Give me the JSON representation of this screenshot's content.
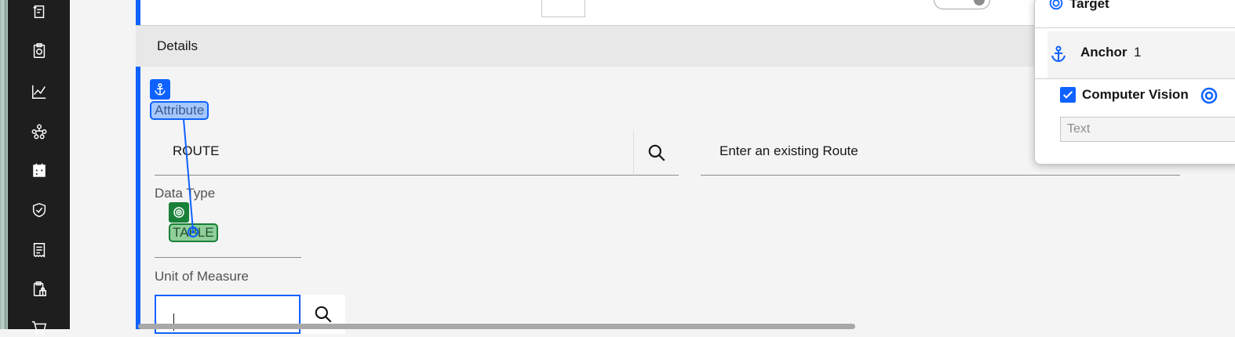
{
  "details": {
    "title": "Details"
  },
  "attribute": {
    "label": "Attribute",
    "value": "ROUTE",
    "description": "Enter an existing Route"
  },
  "data_type": {
    "label": "Data Type",
    "value": "TABLE"
  },
  "unit_of_measure": {
    "label": "Unit of Measure",
    "value": ""
  },
  "panel": {
    "target_label": "Target",
    "anchor_label": "Anchor",
    "anchor_count": "1",
    "computer_vision_label": "Computer Vision",
    "computer_vision_checked": true,
    "text_placeholder": "Text"
  },
  "sidebar": {
    "icons": [
      "history-icon",
      "clipboard-sync-icon",
      "line-chart-icon",
      "hierarchy-icon",
      "calendar-icon",
      "shield-check-icon",
      "receipt-icon",
      "clipboard-lock-icon",
      "cart-icon"
    ]
  },
  "colors": {
    "accent": "#0f62fe",
    "target": "#198038",
    "sidebar": "#1e1e1e"
  }
}
